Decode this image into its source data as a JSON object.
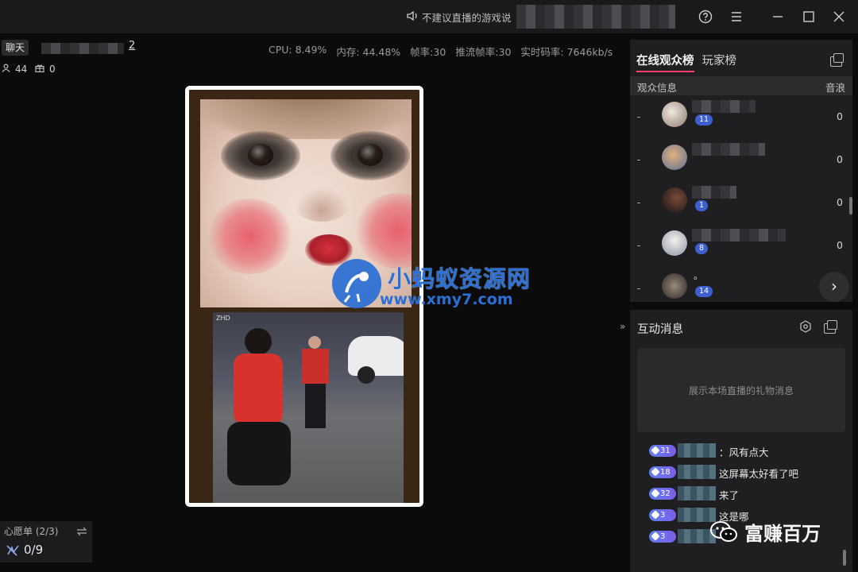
{
  "titlebar": {
    "notice": "不建议直播的游戏说"
  },
  "room": {
    "chat_tag": "聊天",
    "name_suffix": "2",
    "viewers": "44",
    "gifts": "0"
  },
  "stats": {
    "cpu": "CPU: 8.49%",
    "memory": "内存: 44.48%",
    "fps": "帧率:30",
    "push_fps": "推流帧率:30",
    "bitrate": "实时码率: 7646kb/s"
  },
  "stream": {
    "overlay_tag": "ZHD",
    "watermark_title": "小蚂蚁资源网",
    "watermark_url": "www.xmy7.com"
  },
  "wishlist": {
    "title": "心愿单 (2/3)",
    "count": "0/9"
  },
  "audience": {
    "tab_online": "在线观众榜",
    "tab_players": "玩家榜",
    "col_info": "观众信息",
    "col_score": "音浪",
    "rows": [
      {
        "rank": "-",
        "badge": "11",
        "score": "0"
      },
      {
        "rank": "-",
        "badge": "",
        "score": "0"
      },
      {
        "rank": "-",
        "badge": "1",
        "score": "0"
      },
      {
        "rank": "-",
        "badge": "8",
        "score": "0"
      },
      {
        "rank": "-",
        "badge": "14",
        "score": ""
      }
    ],
    "row5_name": "。"
  },
  "interaction": {
    "title": "互动消息",
    "gift_placeholder": "展示本场直播的礼物消息",
    "messages": [
      {
        "level": "31",
        "text": "：风有点大"
      },
      {
        "level": "18",
        "text": "这屏幕太好看了吧"
      },
      {
        "level": "32",
        "text": "来了"
      },
      {
        "level": "3",
        "text": "这是哪"
      },
      {
        "level": "3",
        "text": ""
      }
    ]
  },
  "footer_watermark": "富赚百万",
  "colors": {
    "accent": "#ff3d6b",
    "badge": "#3d5fcf",
    "watermark": "#2a6fd6"
  }
}
